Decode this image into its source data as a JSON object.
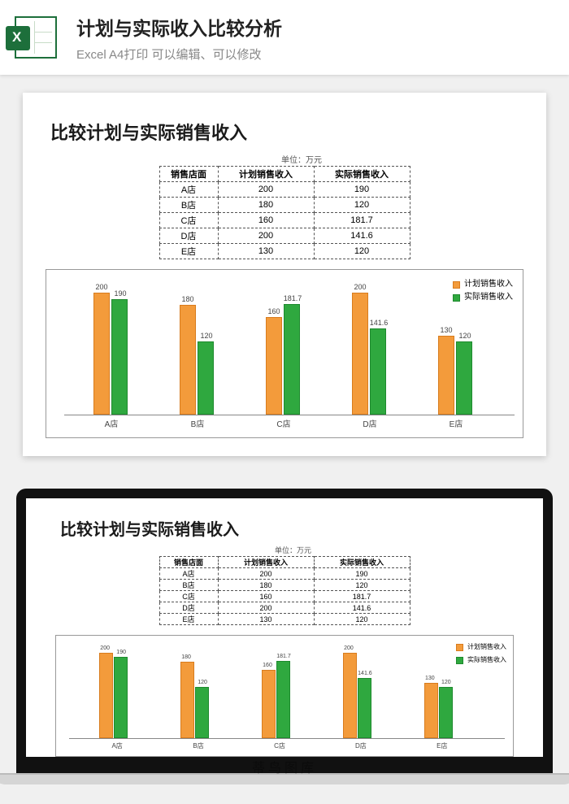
{
  "header": {
    "title": "计划与实际收入比较分析",
    "subtitle": "Excel A4打印 可以编辑、可以修改"
  },
  "document": {
    "title": "比较计划与实际销售收入",
    "unit_label": "单位：万元",
    "columns": [
      "销售店面",
      "计划销售收入",
      "实际销售收入"
    ],
    "rows": [
      {
        "store": "A店",
        "plan": "200",
        "actual": "190"
      },
      {
        "store": "B店",
        "plan": "180",
        "actual": "120"
      },
      {
        "store": "C店",
        "plan": "160",
        "actual": "181.7"
      },
      {
        "store": "D店",
        "plan": "200",
        "actual": "141.6"
      },
      {
        "store": "E店",
        "plan": "130",
        "actual": "120"
      }
    ]
  },
  "legend": {
    "plan": "计划销售收入",
    "actual": "实际销售收入"
  },
  "colors": {
    "plan": "#f39b3b",
    "actual": "#2fa83f"
  },
  "watermark": "蒂鸟图库",
  "chart_data": {
    "type": "bar",
    "title": "比较计划与实际销售收入",
    "ylabel": "万元",
    "ylim": [
      0,
      200
    ],
    "categories": [
      "A店",
      "B店",
      "C店",
      "D店",
      "E店"
    ],
    "series": [
      {
        "name": "计划销售收入",
        "values": [
          200,
          180,
          160,
          200,
          130
        ]
      },
      {
        "name": "实际销售收入",
        "values": [
          190,
          120,
          181.7,
          141.6,
          120
        ]
      }
    ]
  }
}
